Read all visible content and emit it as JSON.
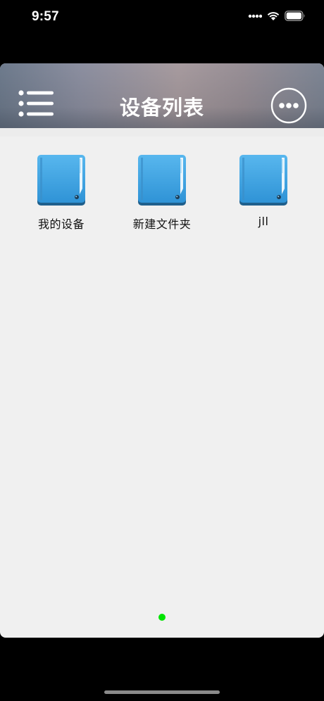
{
  "status_bar": {
    "time": "9:57"
  },
  "header": {
    "title": "设备列表",
    "menu_icon": "list-menu-icon",
    "more_icon": "more-options-icon"
  },
  "folders": [
    {
      "label": "我的设备",
      "icon": "folder-icon"
    },
    {
      "label": "新建文件夹",
      "icon": "folder-icon"
    },
    {
      "label": "jll",
      "icon": "folder-icon"
    }
  ],
  "colors": {
    "folder_blue": "#3fa3e0",
    "page_indicator": "#00e400",
    "background": "#f0f0f0"
  }
}
